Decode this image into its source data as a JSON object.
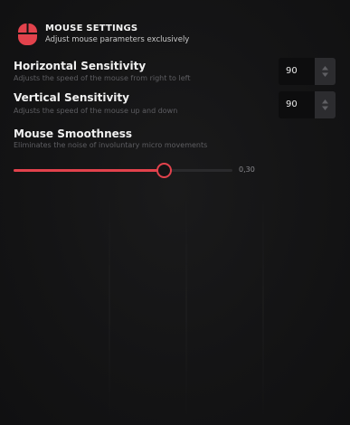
{
  "header": {
    "title": "MOUSE SETTINGS",
    "subtitle": "Adjust mouse parameters exclusively",
    "icon": "mouse-icon",
    "accent_color": "#e2424c"
  },
  "settings": {
    "horizontal": {
      "title": "Horizontal Sensitivity",
      "description": "Adjusts the speed of the mouse from right to left",
      "value": "90",
      "stepper_icon": "up-down-arrows-icon"
    },
    "vertical": {
      "title": "Vertical Sensitivity",
      "description": "Adjusts the speed of the mouse up and down",
      "value": "90",
      "stepper_icon": "up-down-arrows-icon"
    },
    "smoothness": {
      "title": "Mouse Smoothness",
      "description": "Eliminates the noise of involuntary micro movements",
      "value_label": "0,30",
      "fill_fraction": 0.69
    }
  }
}
